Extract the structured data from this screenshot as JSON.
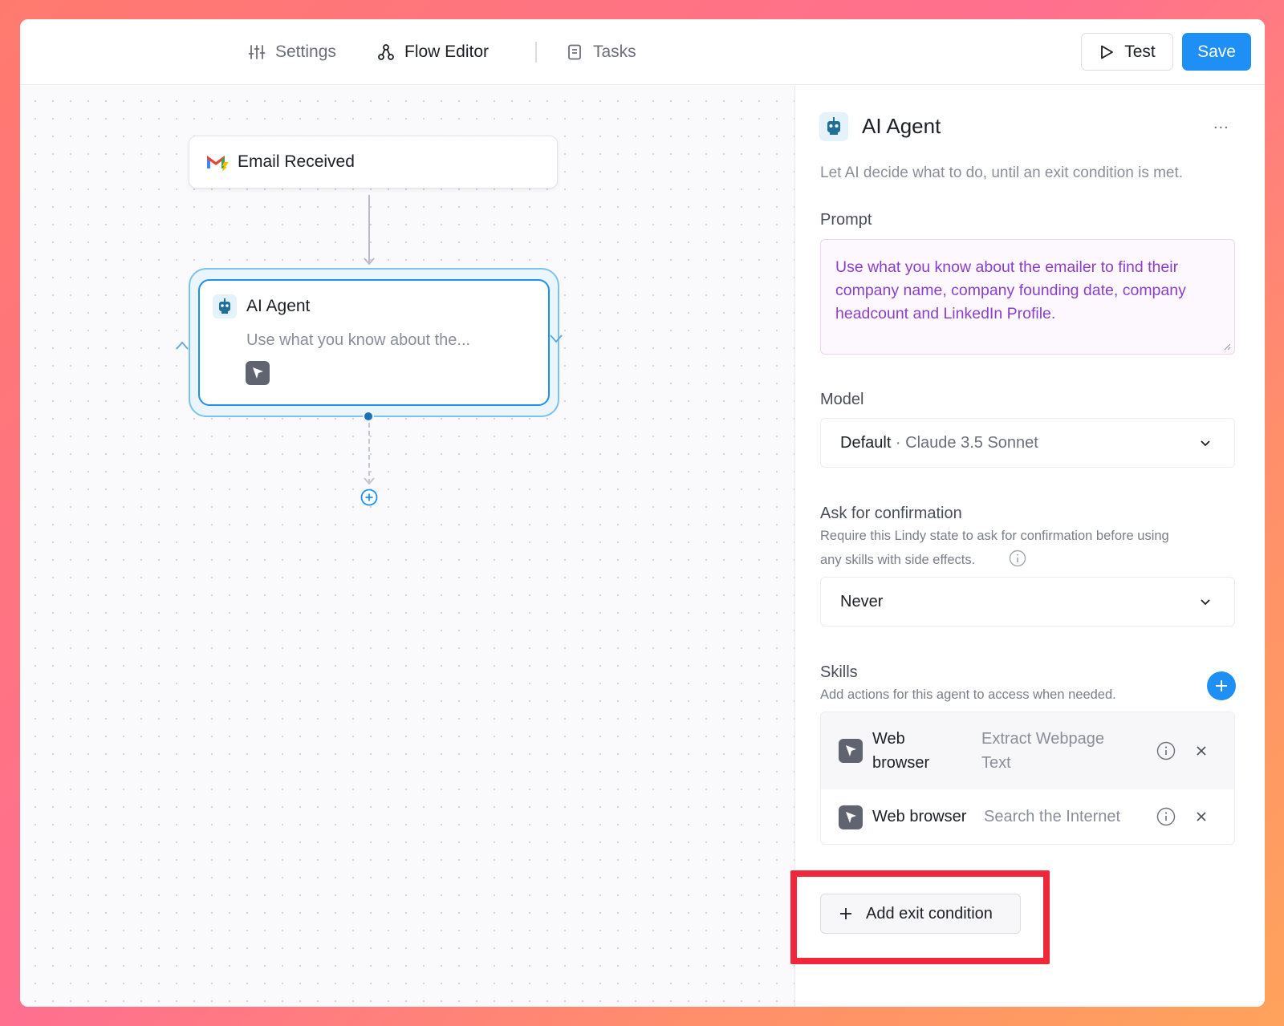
{
  "header": {
    "tabs": [
      {
        "label": "Settings",
        "icon": "sliders-icon"
      },
      {
        "label": "Flow Editor",
        "icon": "flow-icon"
      },
      {
        "label": "Tasks",
        "icon": "tasks-icon"
      }
    ],
    "test_label": "Test",
    "save_label": "Save"
  },
  "canvas": {
    "trigger_node": {
      "label": "Email Received",
      "icon": "gmail-icon"
    },
    "agent_node": {
      "title": "AI Agent",
      "description": "Use what you know about the...",
      "icon": "robot-icon",
      "skill_icon": "web-browser-icon"
    }
  },
  "panel": {
    "title": "AI Agent",
    "more": "...",
    "description": "Let AI decide what to do, until an exit condition is met.",
    "prompt_label": "Prompt",
    "prompt_text": "Use what you know about the emailer to find their company name, company founding date, company headcount and LinkedIn Profile.",
    "model_label": "Model",
    "model_default": "Default",
    "model_sep": " · ",
    "model_value": "Claude 3.5 Sonnet",
    "confirm_label": "Ask for confirmation",
    "confirm_help_1": "Require this Lindy state to ask for confirmation before using",
    "confirm_help_2": "any skills with side effects.",
    "confirm_value": "Never",
    "skills_label": "Skills",
    "skills_help": "Add actions for this agent to access when needed.",
    "skills": [
      {
        "name_1": "Web",
        "name_2": "browser",
        "desc_1": "Extract Webpage",
        "desc_2": "Text"
      },
      {
        "name": "Web browser",
        "desc": "Search the Internet"
      }
    ],
    "exit_label": "Add exit condition"
  },
  "colors": {
    "accent": "#1e90f5",
    "highlight": "#f0273a",
    "prompt_text": "#8b3fc8"
  }
}
